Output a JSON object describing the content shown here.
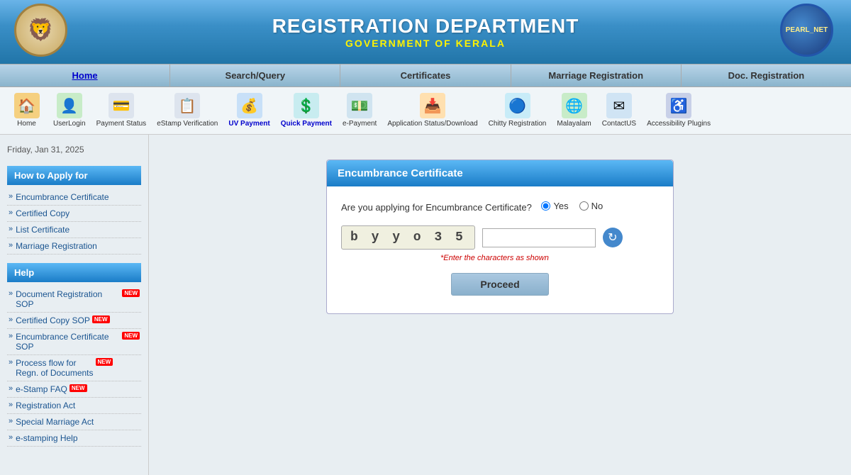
{
  "header": {
    "title": "REGISTRATION DEPARTMENT",
    "subtitle": "GOVERNMENT OF KERALA"
  },
  "navbar": {
    "items": [
      {
        "label": "Home",
        "active": true
      },
      {
        "label": "Search/Query",
        "active": false
      },
      {
        "label": "Certificates",
        "active": false
      },
      {
        "label": "Marriage Registration",
        "active": false
      },
      {
        "label": "Doc. Registration",
        "active": false
      }
    ]
  },
  "toolbar": {
    "items": [
      {
        "id": "home",
        "label": "Home",
        "icon": "🏠",
        "color": "#e8a030"
      },
      {
        "id": "userlogin",
        "label": "UserLogin",
        "icon": "👤",
        "color": "#44aa44"
      },
      {
        "id": "payment-status",
        "label": "Payment Status",
        "icon": "💳",
        "color": "#7788aa"
      },
      {
        "id": "estamp",
        "label": "eStamp Verification",
        "icon": "📋",
        "color": "#7788aa"
      },
      {
        "id": "uv-payment",
        "label": "UV Payment",
        "icon": "💰",
        "color": "#4488cc"
      },
      {
        "id": "quick-payment",
        "label": "Quick Payment",
        "icon": "💲",
        "color": "#44aacc"
      },
      {
        "id": "epayment",
        "label": "e-Payment",
        "icon": "💵",
        "color": "#5588aa"
      },
      {
        "id": "app-status",
        "label": "Application Status/Download",
        "icon": "📥",
        "color": "#cc7700"
      },
      {
        "id": "chitty",
        "label": "Chitty Registration",
        "icon": "🔵",
        "color": "#44aacc"
      },
      {
        "id": "malayalam",
        "label": "Malayalam",
        "icon": "🌐",
        "color": "#44aa44"
      },
      {
        "id": "contactus",
        "label": "ContactUS",
        "icon": "✉",
        "color": "#4488cc"
      },
      {
        "id": "accessibility",
        "label": "Accessibility Plugins",
        "icon": "♿",
        "color": "#114488"
      }
    ]
  },
  "sidebar": {
    "date": "Friday, Jan 31, 2025",
    "how_to_apply_title": "How to Apply for",
    "apply_items": [
      {
        "label": "Encumbrance Certificate"
      },
      {
        "label": "Certified Copy"
      },
      {
        "label": "List Certificate"
      },
      {
        "label": "Marriage Registration"
      }
    ],
    "help_title": "Help",
    "help_items": [
      {
        "label": "Document Registration SOP",
        "new": true
      },
      {
        "label": "Certified Copy SOP",
        "new": true
      },
      {
        "label": "Encumbrance Certificate SOP",
        "new": true
      },
      {
        "label": "Process flow for Regn. of Documents",
        "new": true
      },
      {
        "label": "e-Stamp FAQ",
        "new": true
      },
      {
        "label": "Registration Act",
        "new": false
      },
      {
        "label": "Special Marriage Act",
        "new": false
      },
      {
        "label": "e-stamping Help",
        "new": false
      }
    ]
  },
  "form": {
    "title": "Encumbrance Certificate",
    "question": "Are you applying for Encumbrance Certificate?",
    "yes_label": "Yes",
    "no_label": "No",
    "captcha_value": "b y y o 3 5",
    "captcha_placeholder": "",
    "captcha_hint": "*Enter the characters as shown",
    "proceed_label": "Proceed"
  }
}
